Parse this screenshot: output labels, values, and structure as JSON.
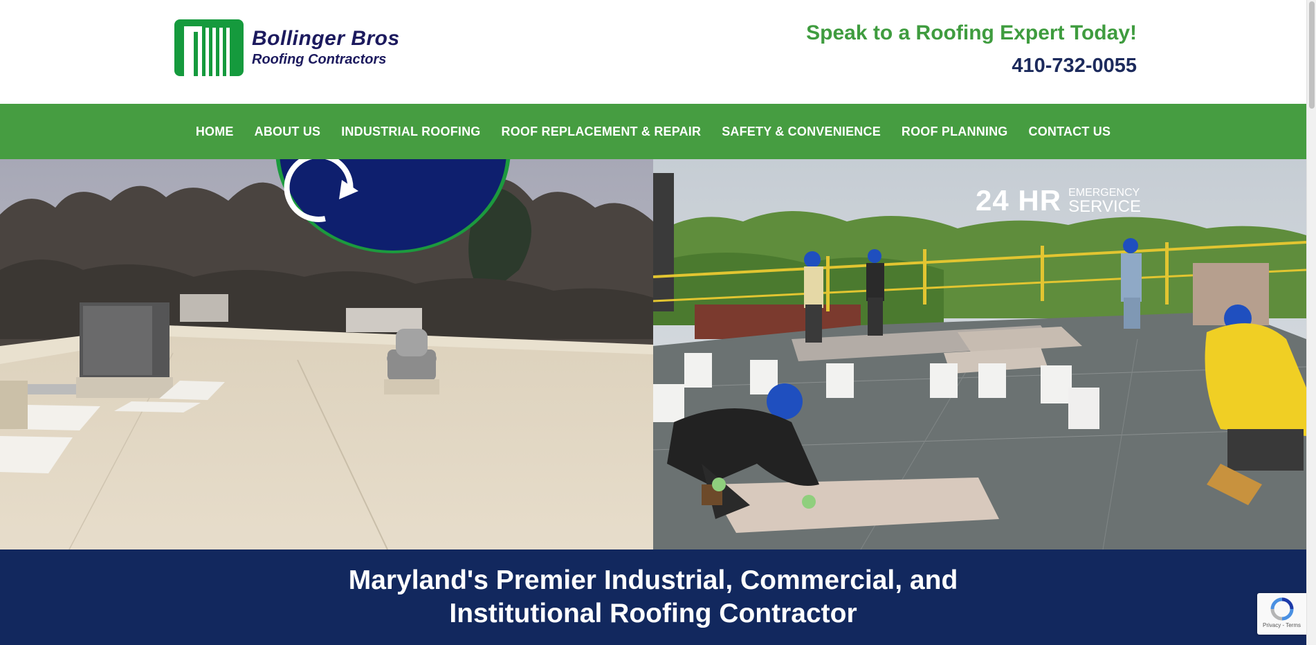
{
  "logo": {
    "name": "Bollinger Bros",
    "subtitle": "Roofing Contractors",
    "colors": {
      "green": "#159a3d",
      "navy": "#1c1a5e"
    }
  },
  "header": {
    "tagline": "Speak to a Roofing Expert Today!",
    "phone": "410-732-0055"
  },
  "nav": {
    "items": [
      {
        "label": "HOME"
      },
      {
        "label": "ABOUT US"
      },
      {
        "label": "INDUSTRIAL ROOFING"
      },
      {
        "label": "ROOF REPLACEMENT & REPAIR"
      },
      {
        "label": "SAFETY & CONVENIENCE"
      },
      {
        "label": "ROOF PLANNING"
      },
      {
        "label": "CONTACT US"
      }
    ],
    "color": "#469d41"
  },
  "badge": {
    "main": "24 HR",
    "line1": "EMERGENCY",
    "line2": "SERVICE",
    "colors": {
      "fill": "#0e1f6e",
      "border": "#1c9a3e"
    }
  },
  "banner": {
    "line1": "Maryland's Premier Industrial, Commercial, and",
    "line2": "Institutional Roofing Contractor",
    "color": "#12285e"
  },
  "recaptcha": {
    "privacy": "Privacy",
    "terms": "Terms"
  }
}
